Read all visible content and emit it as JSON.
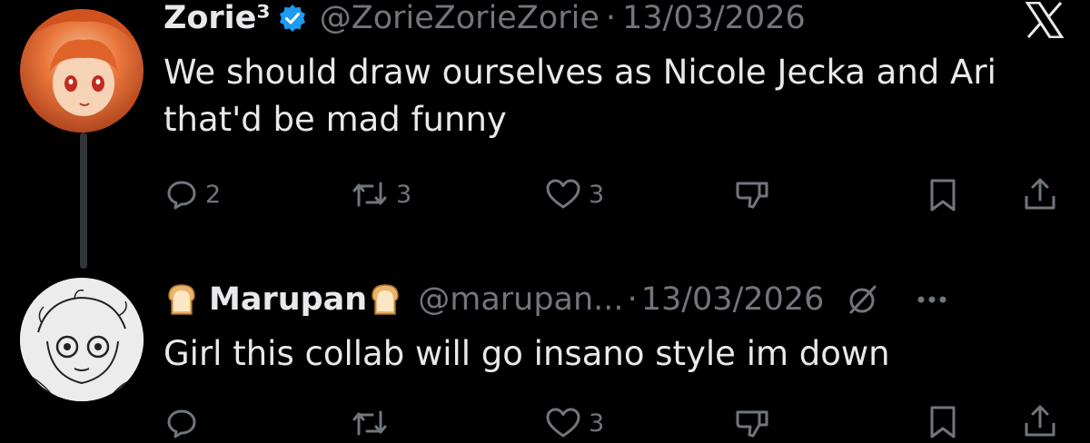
{
  "tweets": [
    {
      "display_name": "Zorie³",
      "verified": true,
      "handle": "@ZorieZorieZorie",
      "separator": "·",
      "date": "13/03/2026",
      "text_line1": "We should draw ourselves as Nicole Jecka and Ari",
      "text_line2": "that'd be mad funny",
      "replies": "2",
      "reposts": "3",
      "likes": "3"
    },
    {
      "display_name": "Marupan",
      "name_emoji": "bread",
      "handle": "@marupan...",
      "separator": "·",
      "date": "13/03/2026",
      "text": "Girl this collab will go insano style im down",
      "replies": "",
      "reposts": "",
      "likes": "3"
    }
  ],
  "icons": {
    "app_logo": "x-logo-icon",
    "verified": "verified-badge-icon",
    "reply": "reply-icon",
    "repost": "repost-icon",
    "like": "heart-icon",
    "dislike": "thumbs-down-icon",
    "bookmark": "bookmark-icon",
    "share": "share-icon",
    "grok": "grok-icon",
    "more": "more-icon"
  },
  "colors": {
    "background": "#000000",
    "primary_text": "#e7e9ea",
    "secondary_text": "#71767b",
    "verified_blue": "#1d9bf0"
  }
}
